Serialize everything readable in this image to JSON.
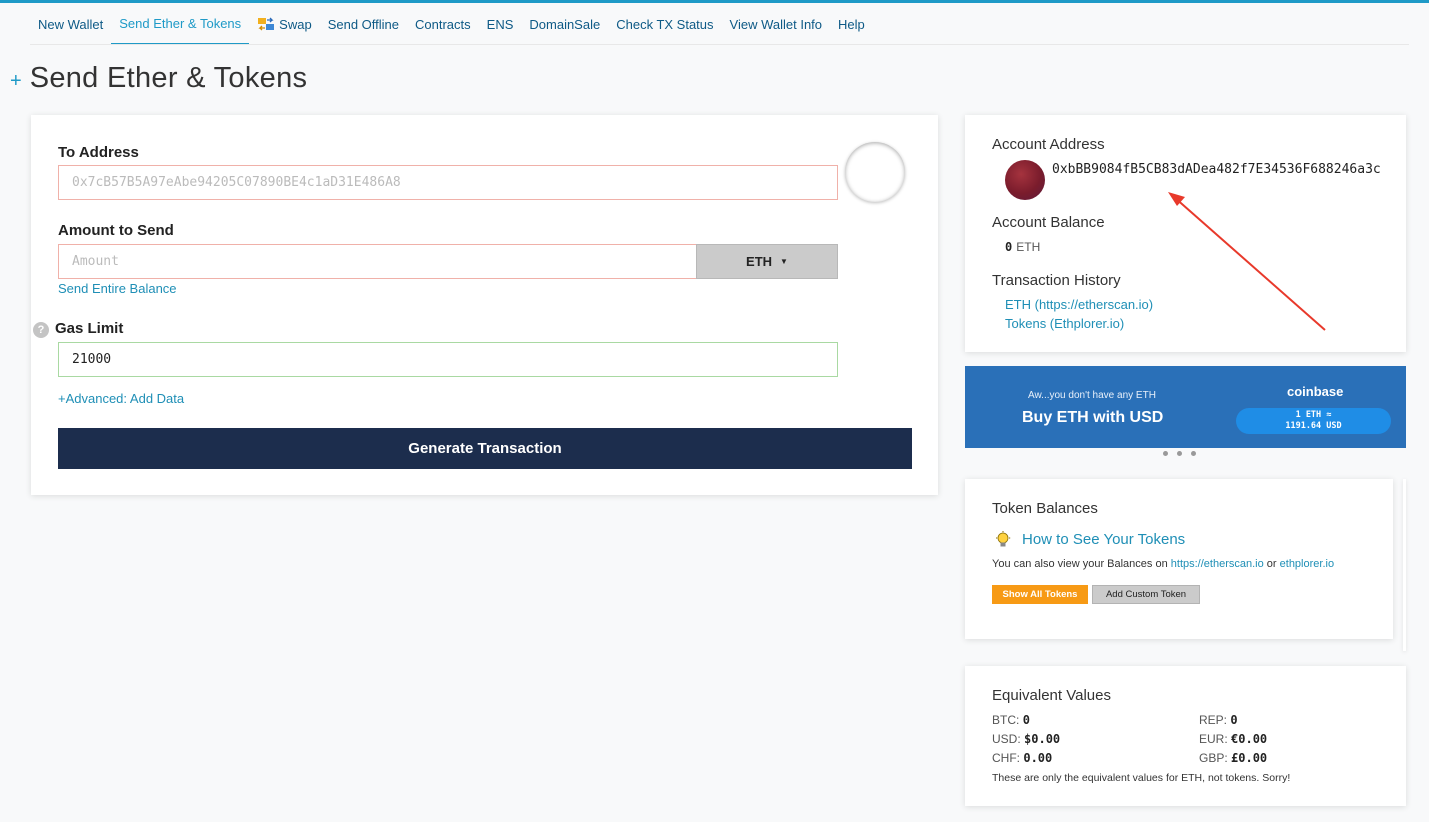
{
  "nav": {
    "items": [
      {
        "label": "New Wallet"
      },
      {
        "label": "Send Ether & Tokens"
      },
      {
        "label": "Swap"
      },
      {
        "label": "Send Offline"
      },
      {
        "label": "Contracts"
      },
      {
        "label": "ENS"
      },
      {
        "label": "DomainSale"
      },
      {
        "label": "Check TX Status"
      },
      {
        "label": "View Wallet Info"
      },
      {
        "label": "Help"
      }
    ],
    "active_index": 1
  },
  "page": {
    "plus": "+",
    "title": "Send Ether & Tokens"
  },
  "send_form": {
    "to_address_label": "To Address",
    "to_address_placeholder": "0x7cB57B5A97eAbe94205C07890BE4c1aD31E486A8",
    "amount_label": "Amount to Send",
    "amount_placeholder": "Amount",
    "unit": "ETH",
    "send_entire_balance": "Send Entire Balance",
    "help_glyph": "?",
    "gas_limit_label": "Gas Limit",
    "gas_limit_value": "21000",
    "advanced_link": "+Advanced: Add Data",
    "generate_button": "Generate Transaction"
  },
  "account": {
    "address_label": "Account Address",
    "address": "0xbBB9084fB5CB83dADea482f7E34536F688246a3c",
    "balance_label": "Account Balance",
    "balance_value": "0",
    "balance_unit": "ETH",
    "history_label": "Transaction History",
    "history_links": [
      "ETH (https://etherscan.io)",
      "Tokens (Ethplorer.io)"
    ]
  },
  "coinbase": {
    "small_text": "Aw...you don't have any ETH",
    "big_text": "Buy ETH with USD",
    "logo": "coinbase",
    "rate_line1": "1 ETH ≈",
    "rate_line2": "1191.64 USD"
  },
  "tokens": {
    "title": "Token Balances",
    "howto_link": "How to See Your Tokens",
    "note_prefix": "You can also view your Balances on",
    "note_link1": "https://etherscan.io",
    "note_or": "or",
    "note_link2": "ethplorer.io",
    "show_all": "Show All Tokens",
    "add_custom": "Add Custom Token"
  },
  "equivalent": {
    "title": "Equivalent Values",
    "rows": [
      {
        "label": "BTC:",
        "value": "0"
      },
      {
        "label": "REP:",
        "value": "0"
      },
      {
        "label": "USD:",
        "value": "$0.00"
      },
      {
        "label": "EUR:",
        "value": "€0.00"
      },
      {
        "label": "CHF:",
        "value": "0.00"
      },
      {
        "label": "GBP:",
        "value": "£0.00"
      }
    ],
    "note": "These are only the equivalent values for ETH, not tokens. Sorry!"
  },
  "colors": {
    "accent": "#1f9ac7",
    "button_dark": "#1c2d4d",
    "coinbase_blue": "#2a70b8",
    "orange": "#f79a15",
    "annotation_arrow": "#e8392b"
  }
}
